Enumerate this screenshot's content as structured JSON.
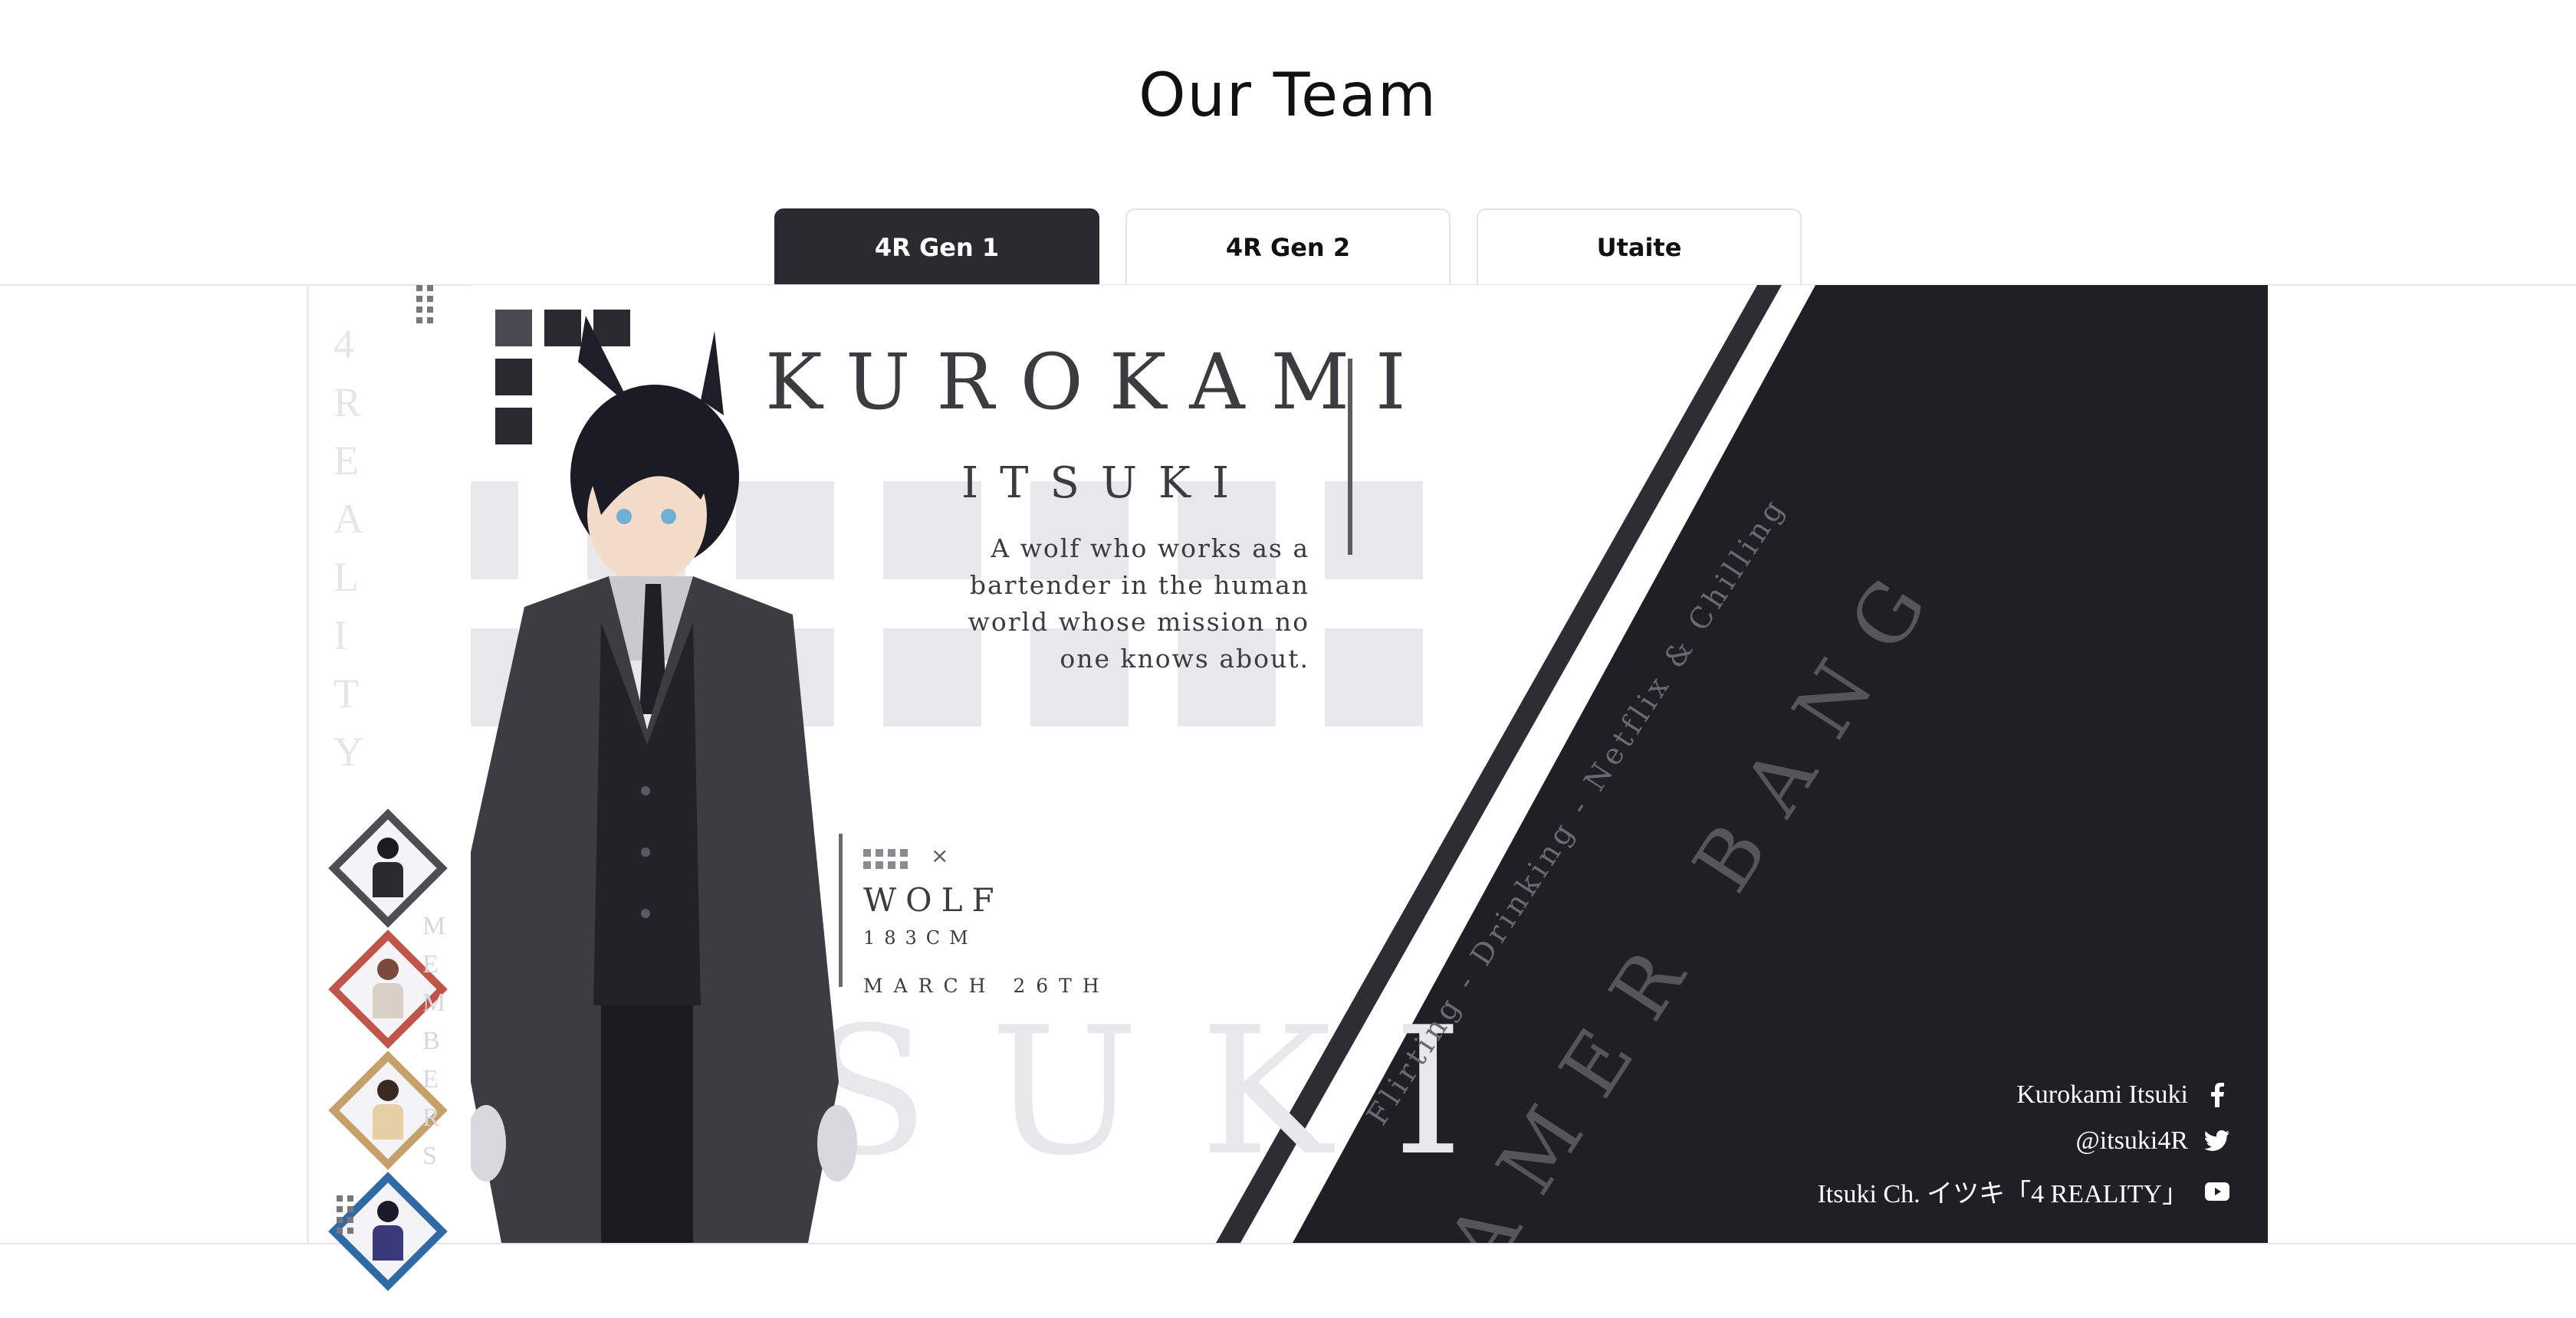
{
  "page": {
    "title": "Our Team"
  },
  "tabs": [
    {
      "label": "4R Gen 1",
      "active": true
    },
    {
      "label": "4R Gen 2",
      "active": false
    },
    {
      "label": "Utaite",
      "active": false
    }
  ],
  "sidebar": {
    "vertical_text": [
      "4",
      "R",
      "E",
      "A",
      "L",
      "I",
      "T",
      "Y"
    ],
    "members_text": [
      "M",
      "E",
      "M",
      "B",
      "E",
      "R",
      "S"
    ],
    "avatars": [
      {
        "name": "Kurokami Itsuki",
        "frame_color": "#4d4d54"
      },
      {
        "name": "member-2",
        "frame_color": "#c0544b"
      },
      {
        "name": "member-3",
        "frame_color": "#c6a06a"
      },
      {
        "name": "member-4",
        "frame_color": "#2f6aa6"
      }
    ]
  },
  "profile": {
    "last_name": "KUROKAMI",
    "first_name": "ITSUKI",
    "description": "A wolf who works as a bartender in the human world whose mission no one knows about.",
    "species": "WOLF",
    "height": "183CM",
    "birthday": "MARCH 26TH",
    "background_word": "SUKI",
    "hobbies": "Flirting - Drinking - Netflix & Chilling",
    "role": "AMER BANG",
    "close_glyph": "×"
  },
  "socials": [
    {
      "label": "Kurokami Itsuki",
      "icon": "facebook-icon"
    },
    {
      "label": "@itsuki4R",
      "icon": "twitter-icon"
    },
    {
      "label": "Itsuki Ch. イツキ「4 REALITY」",
      "icon": "youtube-icon"
    }
  ],
  "colors": {
    "dark_panel": "#1f1f26",
    "tab_active": "#2a2a30",
    "accent_gray": "#3b3b40"
  }
}
